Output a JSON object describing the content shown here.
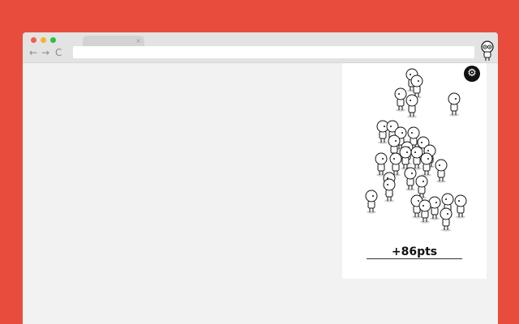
{
  "browser": {
    "tab_close": "×",
    "nav": {
      "back": "←",
      "forward": "→",
      "reload": "C"
    },
    "address": ""
  },
  "game": {
    "settings_icon": "gear-icon",
    "score_text": "+86pts"
  },
  "colors": {
    "background": "#e84c3d",
    "panel": "#ffffff",
    "stickman": "#111111"
  }
}
